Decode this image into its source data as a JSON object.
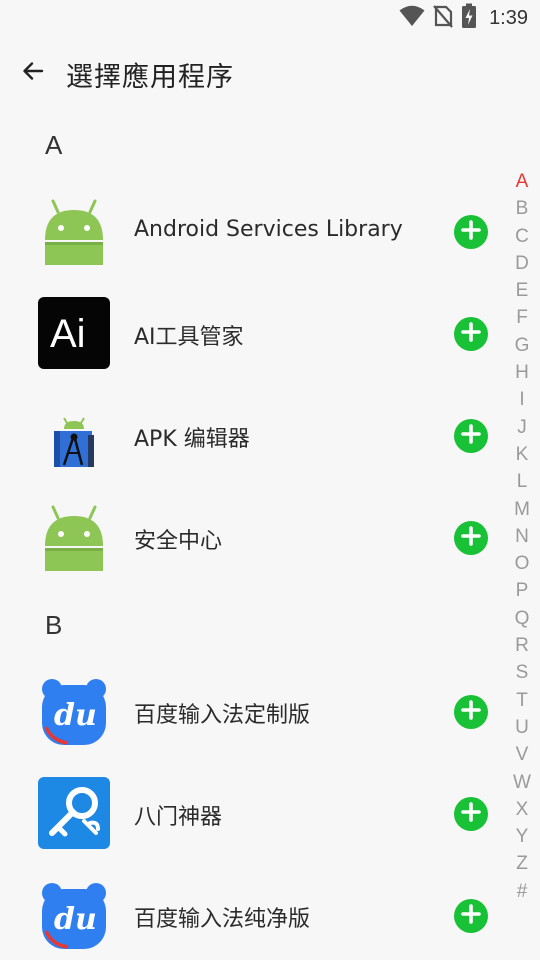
{
  "status_bar": {
    "time": "1:39",
    "icons": [
      "wifi-icon",
      "no-sim-icon",
      "battery-charging-icon"
    ]
  },
  "header": {
    "title": "選擇應用程序",
    "back_icon": "arrow-left-icon"
  },
  "sections": [
    {
      "letter": "A",
      "apps": [
        {
          "name": "Android Services Library",
          "icon": "android-icon"
        },
        {
          "name": "AI工具管家",
          "icon": "ai-logo-icon",
          "icon_text": "Ai"
        },
        {
          "name": "APK 编辑器",
          "icon": "apk-editor-icon"
        },
        {
          "name": "安全中心",
          "icon": "android-icon"
        }
      ]
    },
    {
      "letter": "B",
      "apps": [
        {
          "name": "百度输入法定制版",
          "icon": "baidu-input-icon",
          "icon_text": "du"
        },
        {
          "name": "八门神器",
          "icon": "bamen-key-icon"
        },
        {
          "name": "百度输入法纯净版",
          "icon": "baidu-input-icon",
          "icon_text": "du"
        }
      ]
    }
  ],
  "add_icon": "plus-circle-icon",
  "alphabet_index": {
    "letters": [
      "A",
      "B",
      "C",
      "D",
      "E",
      "F",
      "G",
      "H",
      "I",
      "J",
      "K",
      "L",
      "M",
      "N",
      "O",
      "P",
      "Q",
      "R",
      "S",
      "T",
      "U",
      "V",
      "W",
      "X",
      "Y",
      "Z",
      "#"
    ],
    "active": "A"
  },
  "colors": {
    "background": "#f7f7f7",
    "add_button": "#19c136",
    "active_index": "#e53935",
    "index_inactive": "#9a9a9a",
    "android_green": "#8dc655",
    "baidu_blue": "#2f7ff0",
    "bamen_blue": "#1e88e5"
  }
}
